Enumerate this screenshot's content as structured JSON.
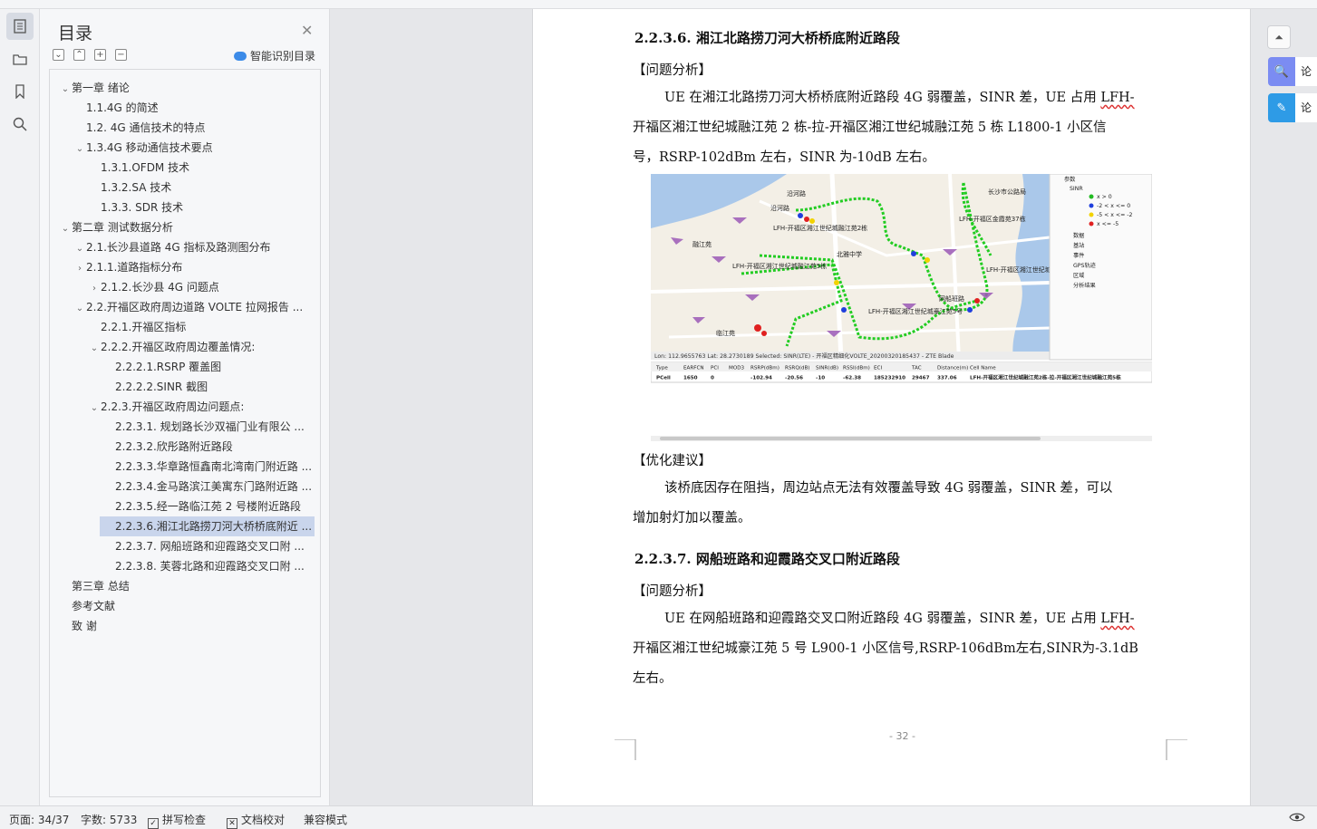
{
  "toc": {
    "title": "目录",
    "smart_label": "智能识别目录",
    "items": [
      {
        "label": "第一章  绪论",
        "arrow": "⌄"
      },
      {
        "label": "1.1.4G 的简述",
        "arrow": ""
      },
      {
        "label": "1.2.  4G 通信技术的特点",
        "arrow": ""
      },
      {
        "label": "1.3.4G 移动通信技术要点",
        "arrow": "⌄"
      },
      {
        "label": "1.3.1.OFDM 技术",
        "arrow": ""
      },
      {
        "label": "1.3.2.SA 技术",
        "arrow": ""
      },
      {
        "label": "1.3.3.  SDR 技术",
        "arrow": ""
      },
      {
        "label": "第二章  测试数据分析",
        "arrow": "⌄"
      },
      {
        "label": "2.1.长沙县道路 4G 指标及路测图分布",
        "arrow": "⌄"
      },
      {
        "label": "2.1.1.道路指标分布",
        "arrow": "›"
      },
      {
        "label": "2.1.2.长沙县 4G 问题点",
        "arrow": "›"
      },
      {
        "label": "2.2.开福区政府周边道路 VOLTE 拉网报告 ...",
        "arrow": "⌄"
      },
      {
        "label": "2.2.1.开福区指标",
        "arrow": ""
      },
      {
        "label": "2.2.2.开福区政府周边覆盖情况:",
        "arrow": "⌄"
      },
      {
        "label": "2.2.2.1.RSRP 覆盖图",
        "arrow": ""
      },
      {
        "label": "2.2.2.2.SINR 截图",
        "arrow": ""
      },
      {
        "label": "2.2.3.开福区政府周边问题点:",
        "arrow": "⌄"
      },
      {
        "label": "2.2.3.1.  规划路长沙双福门业有限公 ...",
        "arrow": ""
      },
      {
        "label": "2.2.3.2.欣彤路附近路段",
        "arrow": ""
      },
      {
        "label": "2.2.3.3.华章路恒鑫南北湾南门附近路 ...",
        "arrow": ""
      },
      {
        "label": "2.2.3.4.金马路滨江美寓东门路附近路 ...",
        "arrow": ""
      },
      {
        "label": "2.2.3.5.经一路临江苑 2 号楼附近路段",
        "arrow": ""
      },
      {
        "label": "2.2.3.6.湘江北路捞刀河大桥桥底附近 ...",
        "arrow": ""
      },
      {
        "label": "2.2.3.7.  网船班路和迎霞路交叉口附 ...",
        "arrow": ""
      },
      {
        "label": "2.2.3.8.  芙蓉北路和迎霞路交叉口附 ...",
        "arrow": ""
      },
      {
        "label": "第三章  总结",
        "arrow": ""
      },
      {
        "label": "参考文献",
        "arrow": ""
      },
      {
        "label": "致    谢",
        "arrow": ""
      }
    ]
  },
  "doc": {
    "h1": "2.2.3.6.    湘江北路捞刀河大桥桥底附近路段",
    "problem1": "【问题分析】",
    "p1_line1": "UE 在湘江北路捞刀河大桥桥底附近路段 4G 弱覆盖，SINR 差，UE 占用 ",
    "p1_lfh": "LFH-",
    "p1_line2": "开福区湘江世纪城融江苑 2 栋-拉-开福区湘江世纪城融江苑 5 栋 L1800-1 小区信",
    "p1_line3": "号，RSRP-102dBm 左右，SINR 为-10dB 左右。",
    "opt": "【优化建议】",
    "p2_line1": "该桥底因存在阻挡，周边站点无法有效覆盖导致 4G 弱覆盖，SINR 差，可以",
    "p2_line2": "增加射灯加以覆盖。",
    "h2": "2.2.3.7.    网船班路和迎霞路交叉口附近路段",
    "problem2": "【问题分析】",
    "p3_line1": "UE 在网船班路和迎霞路交叉口附近路段 4G 弱覆盖，SINR 差，UE 占用 ",
    "p3_lfh": "LFH-",
    "p3_line2": "开福区湘江世纪城豪江苑 5 号 L900-1 小区信号,RSRP-106dBm左右,SINR为-3.1dB",
    "p3_line3": "左右。",
    "page_number": "- 32 -"
  },
  "map": {
    "legend": [
      "参数",
      "SINR",
      "x > 0",
      "-2 < x <= 0",
      "-5 < x <= -2",
      "x <= -5",
      "数据",
      "基站",
      "事件",
      "GPS轨迹",
      "区域",
      "分析结果"
    ],
    "legend_colors": [
      "#22bb22",
      "#1f3fdd",
      "#f2d200",
      "#e02020"
    ],
    "status_line": "Lon:   112.9655763   Lat:   28.2730189          Selected: SINR(LTE) - 开福区精细化VOLTE_20200320185437 - ZTE Blade",
    "table_headers": [
      "Type",
      "EARFCN",
      "PCI",
      "MOD3",
      "RSRP(dBm)",
      "RSRQ(dB)",
      "SINR(dB)",
      "RSSI(dBm)",
      "ECI",
      "TAC",
      "Distance(m)",
      "Cell Name"
    ],
    "table_row": [
      "PCell",
      "1650",
      "0",
      "",
      "-102.94",
      "-20.56",
      "-10",
      "-62.38",
      "185232910",
      "29467",
      "337.06",
      "LFH-开福区湘江世纪城融江苑2栋-拉-开福区湘江世纪城融江苑5栋"
    ],
    "places": [
      "沿河路",
      "沿河路",
      "融江苑",
      "北雅中学",
      "临江苑",
      "网船班路",
      "长沙市公路局",
      "LFH-开福区金霞苑37栋",
      "LFH-开福区湘江世纪城融江苑2栋",
      "LFH-开福区湘江世纪城融江苑5栋",
      "LFH-开福区湘江世纪城豪江苑5号",
      "LFH-开福区湘江世纪城"
    ]
  },
  "right": {
    "tab1": "论文",
    "tab2": "论文"
  },
  "status": {
    "page": "页面: 34/37",
    "words": "字数: 5733",
    "spell": "拼写检查",
    "proof": "文档校对",
    "compat": "兼容模式"
  }
}
